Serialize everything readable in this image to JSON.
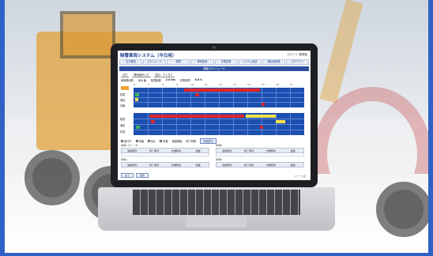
{
  "app": {
    "title": "除雪車両システム（今日用）",
    "user": "ログイン  管理者",
    "nav": [
      "日付確認",
      "スケジュール",
      "帳票",
      "車両登録",
      "作業記録",
      "システム設定",
      "運転者管理",
      "ログアウト"
    ],
    "section_title": "運転スケジュール",
    "tabs": [
      "日付",
      "車両番号入力",
      "表示：デジタル"
    ],
    "info": [
      {
        "label": "稼働車両数",
        "value": "3.0 台"
      },
      {
        "label": "除雪距離",
        "value": "2.0 km"
      },
      {
        "label": "作業時間",
        "value": "0.0 h"
      }
    ],
    "hours": [
      "6",
      "7",
      "8",
      "9",
      "10",
      "11",
      "12",
      "13",
      "14",
      "15",
      "16",
      "17"
    ],
    "row_labels_top": [
      "除雪",
      "運転",
      "待機"
    ],
    "row_labels_bottom": [
      "融雪",
      "凍結",
      "除雪"
    ],
    "legend": [
      "運行中",
      "待機",
      "休止",
      "除雪",
      "融雪開始",
      "終了時間"
    ],
    "detail_button": "詳細表示",
    "table_sections": [
      "車両A  グレーダ",
      "車両B",
      "車両C",
      "車両D"
    ],
    "table_columns": [
      "開始時刻",
      "終了時刻",
      "作業時間",
      "距離"
    ],
    "buttons": [
      "戻る",
      "更新"
    ],
    "page_info": "1 ページ目"
  },
  "colors": {
    "accent": "#2b4f9e",
    "gantt_bg": "#1c4fb0",
    "bar_red": "#e0262a",
    "bar_yellow": "#f5e24c",
    "bar_green": "#3db35a",
    "frame": "#2e62c7"
  }
}
